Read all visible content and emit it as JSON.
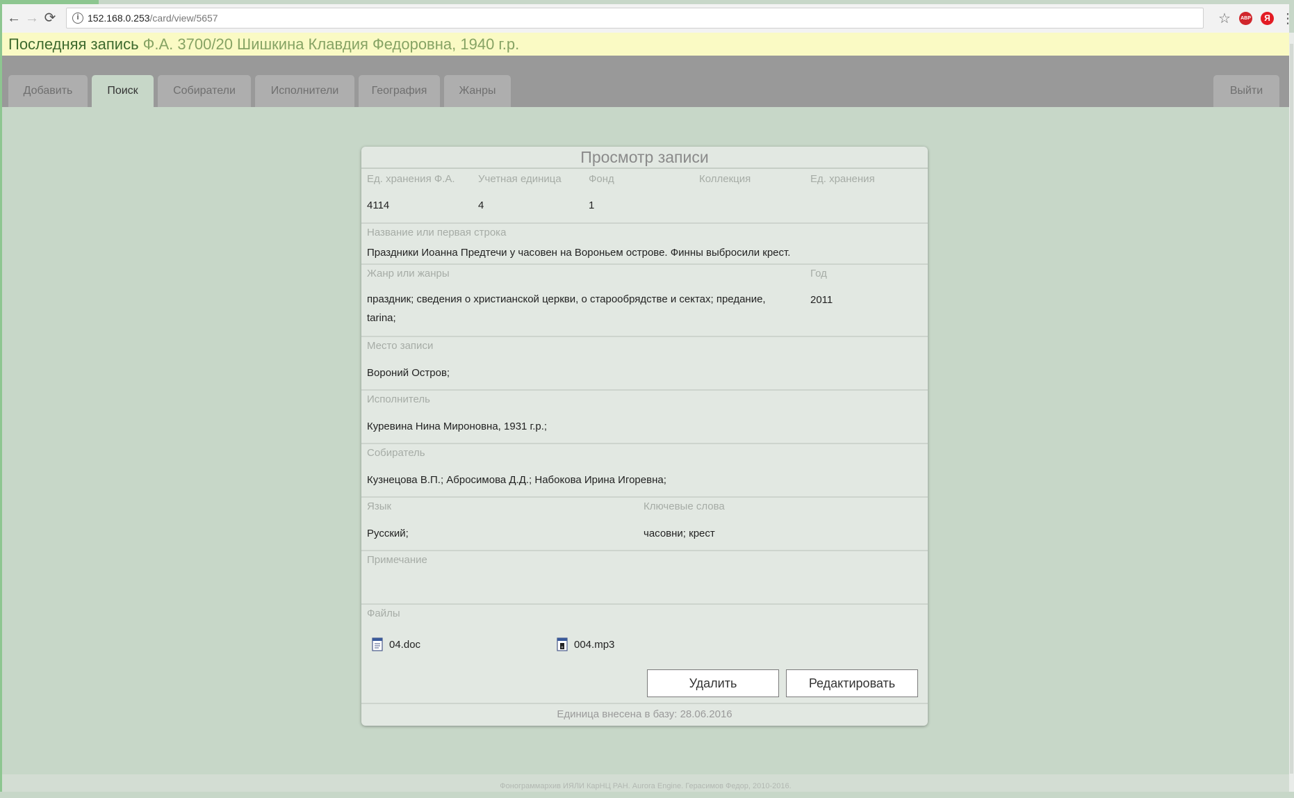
{
  "browser": {
    "url_host": "152.168.0.253",
    "url_path": "/card/view/5657",
    "back": "←",
    "forward": "→",
    "reload": "⟳",
    "info": "i",
    "star": "☆",
    "menu": "⋮",
    "ext1": "ABP",
    "ext2": "Я"
  },
  "last_record": {
    "label": "Последняя запись",
    "value": " Ф.А. 3700/20 Шишкина Клавдия Федоровна, 1940 г.р."
  },
  "tabs": [
    {
      "label": "Добавить"
    },
    {
      "label": "Поиск"
    },
    {
      "label": "Собиратели"
    },
    {
      "label": "Исполнители"
    },
    {
      "label": "География"
    },
    {
      "label": "Жанры"
    }
  ],
  "logout_label": "Выйти",
  "card": {
    "title": "Просмотр записи",
    "headers": [
      "Ед. хранения Ф.А.",
      "Учетная единица",
      "Фонд",
      "Коллекция",
      "Ед. хранения"
    ],
    "values": [
      "4114",
      "4",
      "1",
      "",
      ""
    ],
    "title_label": "Название или первая строка",
    "title_value": "Праздники Иоанна Предтечи у часовен на Вороньем острове. Финны выбросили крест.",
    "genre_label": "Жанр или жанры",
    "genre_value": "праздник; сведения о христианской церкви, о старообрядстве и сектах; предание, tarina;",
    "year_label": "Год",
    "year_value": "2011",
    "place_label": "Место записи",
    "place_value": "Вороний Остров;",
    "performer_label": "Исполнитель",
    "performer_value": "Куревина Нина Мироновна, 1931 г.р.;",
    "collector_label": "Собиратель",
    "collector_value": "Кузнецова В.П.; Абросимова Д.Д.; Набокова Ирина Игоревна;",
    "language_label": "Язык",
    "language_value": "Русский;",
    "keywords_label": "Ключевые слова",
    "keywords_value": "часовни; крест",
    "note_label": "Примечание",
    "note_value": "",
    "files_label": "Файлы",
    "files": [
      {
        "name": "04.doc",
        "icon": "doc-file-icon"
      },
      {
        "name": "004.mp3",
        "icon": "audio-file-icon"
      }
    ],
    "delete_label": "Удалить",
    "edit_label": "Редактировать",
    "footer": "Единица внесена в базу: 28.06.2016"
  },
  "page_footer": "Фонограммархив ИЯЛИ КарНЦ РАН. Aurora Engine. Герасимов Федор, 2010-2016."
}
